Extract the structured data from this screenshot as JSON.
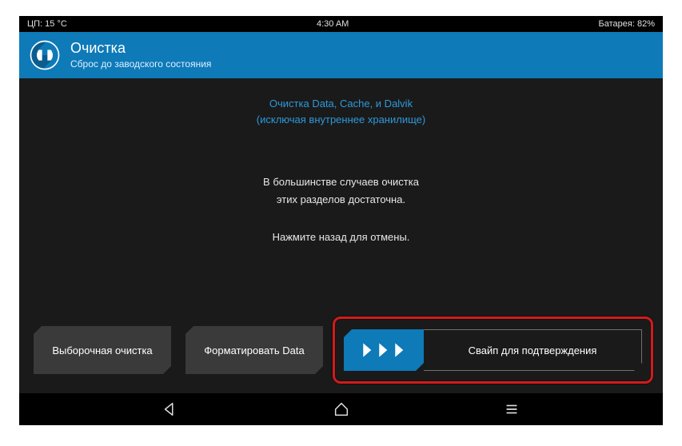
{
  "status": {
    "cpu": "ЦП: 15 °C",
    "time": "4:30 AM",
    "battery": "Батарея: 82%"
  },
  "header": {
    "title": "Очистка",
    "subtitle": "Сброс до заводского состояния"
  },
  "body": {
    "accent_line1": "Очистка Data, Cache, и Dalvik",
    "accent_line2": "(исключая внутреннее хранилище)",
    "info_line1": "В большинстве случаев очистка",
    "info_line2": "этих разделов достаточна.",
    "cancel_hint": "Нажмите назад для отмены."
  },
  "buttons": {
    "advanced_wipe": "Выборочная очистка",
    "format_data": "Форматировать Data",
    "swipe_label": "Свайп для подтверждения"
  }
}
